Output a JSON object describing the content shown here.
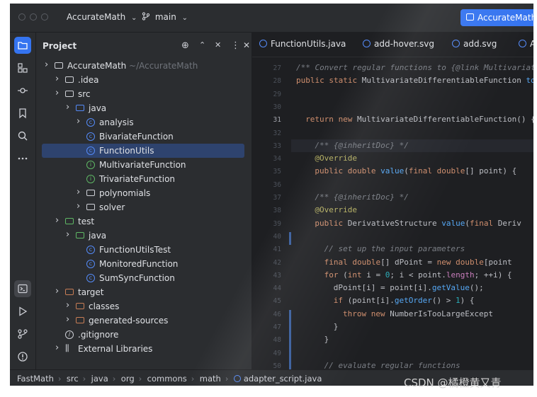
{
  "titlebar": {
    "project": "AccurateMath",
    "branch": "main",
    "right_button": "AccurateMath"
  },
  "project_panel": {
    "title": "Project",
    "tree": [
      {
        "label": "AccurateMath",
        "hint": "~/AccurateMath",
        "kind": "folder",
        "indent": 0,
        "chevron": "right"
      },
      {
        "label": ".idea",
        "kind": "folder",
        "indent": 1,
        "chevron": "right"
      },
      {
        "label": "src",
        "kind": "folder",
        "indent": 1,
        "chevron": "right"
      },
      {
        "label": "java",
        "kind": "folder-blue",
        "indent": 2,
        "chevron": "right"
      },
      {
        "label": "analysis",
        "kind": "class",
        "indent": 3,
        "chevron": "right"
      },
      {
        "label": "BivariateFunction",
        "kind": "class",
        "indent": 3
      },
      {
        "label": "FunctionUtils",
        "kind": "class",
        "indent": 3,
        "selected": true
      },
      {
        "label": "MultivariateFunction",
        "kind": "interface",
        "indent": 3
      },
      {
        "label": "TrivariateFunction",
        "kind": "interface",
        "indent": 3
      },
      {
        "label": "polynomials",
        "kind": "folder",
        "indent": 3,
        "chevron": "right"
      },
      {
        "label": "solver",
        "kind": "folder",
        "indent": 3,
        "chevron": "right"
      },
      {
        "label": "test",
        "kind": "folder-green",
        "indent": 1,
        "chevron": "right"
      },
      {
        "label": "java",
        "kind": "folder-green",
        "indent": 2,
        "chevron": "right"
      },
      {
        "label": "FunctionUtilsTest",
        "kind": "class",
        "indent": 3
      },
      {
        "label": "MonitoredFunction",
        "kind": "class",
        "indent": 3
      },
      {
        "label": "SumSyncFunction",
        "kind": "class",
        "indent": 3
      },
      {
        "label": "target",
        "kind": "folder-orange",
        "indent": 1,
        "chevron": "right"
      },
      {
        "label": "classes",
        "kind": "folder-orange",
        "indent": 2,
        "chevron": "right"
      },
      {
        "label": "generated-sources",
        "kind": "folder-orange",
        "indent": 2,
        "chevron": "right"
      },
      {
        "label": ".gitignore",
        "kind": "ignore",
        "indent": 1
      },
      {
        "label": "External Libraries",
        "kind": "library",
        "indent": 1,
        "chevron": "right"
      }
    ]
  },
  "editor": {
    "tabs": [
      "FunctionUtils.java",
      "add-hover.svg",
      "add.svg",
      "A"
    ],
    "line_numbers": [
      "27",
      "28",
      "29",
      "30",
      "31",
      "32",
      "33",
      "34",
      "35",
      "36",
      "37",
      "38",
      "39",
      "40",
      "41",
      "42",
      "43",
      "44",
      "45",
      "46",
      "47",
      "48",
      "49",
      "50"
    ],
    "lines": [
      {
        "text": "/** Convert regular functions to {@link Multivariate",
        "style": "cmt",
        "indent": 0
      },
      {
        "text": "public static MultivariateDifferentiableFunction toD",
        "style": "sig",
        "indent": 0
      },
      {
        "text": "",
        "indent": 0
      },
      {
        "text": "",
        "indent": 0
      },
      {
        "text": "return new MultivariateDifferentiableFunction() {",
        "style": "ret",
        "indent": 2
      },
      {
        "text": "",
        "indent": 0
      },
      {
        "text": "/** {@inheritDoc} */",
        "style": "cmt",
        "indent": 4
      },
      {
        "text": "@Override",
        "style": "ann",
        "indent": 4
      },
      {
        "text": "public double value(final double[] point) {",
        "style": "m1",
        "indent": 4
      },
      {
        "text": "",
        "indent": 0
      },
      {
        "text": "/** {@inheritDoc} */",
        "style": "cmt",
        "indent": 4
      },
      {
        "text": "@Override",
        "style": "ann",
        "indent": 4
      },
      {
        "text": "public DerivativeStructure value(final Deriv",
        "style": "m2",
        "indent": 4
      },
      {
        "text": "",
        "indent": 0
      },
      {
        "text": "// set up the input parameters",
        "style": "cmt",
        "indent": 6
      },
      {
        "text": "final double[] dPoint = new double[point",
        "style": "decl",
        "indent": 6
      },
      {
        "text": "for (int i = 0; i < point.length; ++i) {",
        "style": "for",
        "indent": 6
      },
      {
        "text": "dPoint[i] = point[i].getValue();",
        "style": "plain",
        "indent": 8
      },
      {
        "text": "if (point[i].getOrder() > 1) {",
        "style": "if",
        "indent": 8
      },
      {
        "text": "throw new NumberIsTooLargeExcept",
        "style": "throw",
        "indent": 10
      },
      {
        "text": "}",
        "style": "plain",
        "indent": 8
      },
      {
        "text": "}",
        "style": "plain",
        "indent": 6
      },
      {
        "text": "",
        "indent": 0
      },
      {
        "text": "// evaluate regular functions",
        "style": "cmt",
        "indent": 6
      }
    ]
  },
  "statusbar": {
    "crumbs": [
      "FastMath",
      "src",
      "java",
      "org",
      "commons",
      "math",
      "adapter_script.java"
    ]
  },
  "watermark": "CSDN @橘橙黄又青"
}
